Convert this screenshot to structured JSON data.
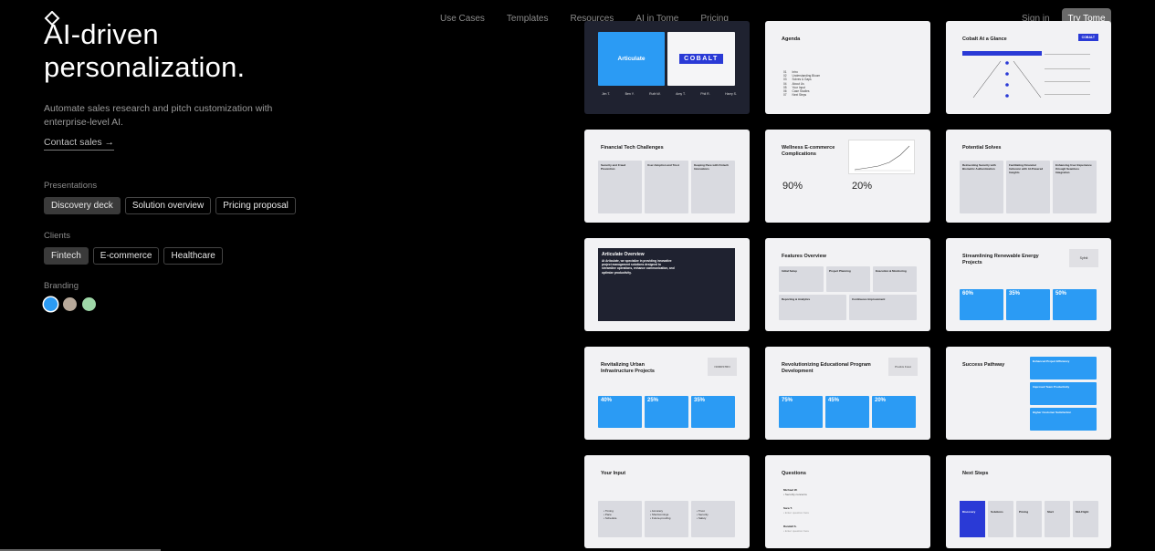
{
  "nav": {
    "items": [
      "Use Cases",
      "Templates",
      "Resources",
      "AI in Tome",
      "Pricing"
    ],
    "signin": "Sign in",
    "try": "Try Tome"
  },
  "hero": {
    "title_line1": "AI-driven",
    "title_line2": "personalization.",
    "description": "Automate sales research and pitch customization with enterprise-level AI.",
    "contact": "Contact sales →"
  },
  "presentations": {
    "label": "Presentations",
    "options": [
      "Discovery deck",
      "Solution overview",
      "Pricing proposal"
    ],
    "selected": "Discovery deck"
  },
  "clients": {
    "label": "Clients",
    "options": [
      "Fintech",
      "E-commerce",
      "Healthcare"
    ],
    "selected": "Fintech"
  },
  "branding": {
    "label": "Branding",
    "colors": [
      "#2b9bf4",
      "#b8a99a",
      "#9fd8a8"
    ]
  },
  "slides": {
    "s1": {
      "brand1": "Articulate",
      "brand2": "COBALT",
      "people": [
        "Jim T.",
        "Ben Y.",
        "Ruth W.",
        "Amy T.",
        "Phil R.",
        "Harry S."
      ]
    },
    "s2": {
      "title": "Agenda",
      "items": [
        "Intro",
        "Understanding Bloom",
        "Solves & Gaps",
        "About Us",
        "Your Input",
        "Case Studies",
        "Next Steps"
      ],
      "nums": [
        "01",
        "02",
        "03",
        "04",
        "05",
        "06",
        "07"
      ]
    },
    "s3": {
      "title": "Cobalt At a Glance",
      "badge": "COBALT"
    },
    "s4": {
      "title": "Financial Tech Challenges",
      "cols": [
        "Security and Fraud Prevention",
        "User Adoption and Trust",
        "Keeping Pace with Fintech Innovations"
      ]
    },
    "s5": {
      "title": "Wellness E-commerce Complications",
      "pct1": "90%",
      "pct2": "20%"
    },
    "s6": {
      "title": "Potential Solves",
      "cols": [
        "Reinventing Security with Biometric Authentication",
        "Facilitating Financial Inclusion with AI-Powered Insights",
        "Enhancing User Experience through Seamless Integration"
      ]
    },
    "s7": {
      "title": "Articulate Overview",
      "body": "At Articulate, we specialize in providing innovative project management solutions designed to streamline operations, enhance communication, and optimize productivity."
    },
    "s8": {
      "title": "Features Overview",
      "boxes": [
        "Initial Setup",
        "Project Planning",
        "Execution & Monitoring",
        "Reporting & Analytics",
        "Continuous Improvement"
      ]
    },
    "s9": {
      "title": "Streamlining Renewable Energy Projects",
      "logo": "Syfnit",
      "stats": [
        "60%",
        "35%",
        "50%"
      ]
    },
    "s10": {
      "title": "Revitalizing Urban Infrastructure Projects",
      "logo": "NORDSTRN",
      "stats": [
        "40%",
        "25%",
        "35%"
      ]
    },
    "s11": {
      "title": "Revolutionizing Educational Program Development",
      "logo": "Prodvix Foret",
      "stats": [
        "75%",
        "45%",
        "20%"
      ]
    },
    "s12": {
      "title": "Success Pathway",
      "steps": [
        "Enhanced Project Efficiency",
        "Improved Team Productivity",
        "Higher Customer Satisfaction"
      ]
    },
    "s13": {
      "title": "Your Input",
      "cols": [
        [
          "Timing",
          "Pace",
          "Schedule"
        ],
        [
          "Accuracy",
          "Shortcomings",
          "Future-proofing"
        ],
        [
          "Trust",
          "Security",
          "Safety"
        ]
      ]
    },
    "s14": {
      "title": "Questions",
      "people": [
        "Michael W.",
        "Sara T.",
        "Randall S."
      ],
      "notes": [
        "Security concerns",
        "Enter question here",
        "Enter question here"
      ]
    },
    "s15": {
      "title": "Next Steps",
      "steps": [
        "Discovery",
        "Solutions",
        "Pricing",
        "Start",
        "Mid-Flight"
      ]
    }
  }
}
